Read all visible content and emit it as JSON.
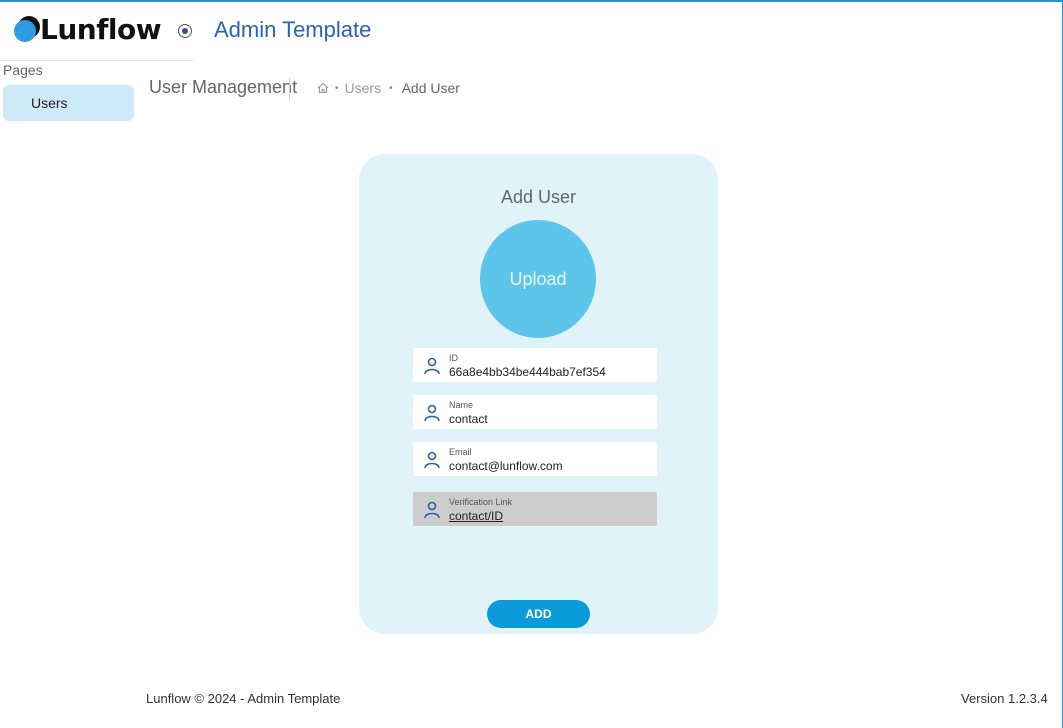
{
  "header": {
    "logo_text": "Lunflow",
    "app_title": "Admin Template",
    "accent_color": "#2e62ad"
  },
  "sidebar": {
    "section_label": "Pages",
    "items": [
      {
        "label": "Users",
        "active": true
      }
    ]
  },
  "breadcrumb": {
    "page_heading": "User Management",
    "home_icon": "home-icon",
    "items": [
      "Users",
      "Add User"
    ]
  },
  "form": {
    "title": "Add User",
    "upload_label": "Upload",
    "fields": [
      {
        "label": "ID",
        "value": "66a8e4bb34be444bab7ef354",
        "icon": "user-icon"
      },
      {
        "label": "Name",
        "value": "contact",
        "icon": "user-icon"
      },
      {
        "label": "Email",
        "value": "contact@lunflow.com",
        "icon": "user-icon"
      },
      {
        "label": "Verification Link",
        "value": "contact/ID",
        "icon": "user-icon",
        "disabled": true
      }
    ],
    "submit_label": "ADD"
  },
  "footer": {
    "copyright": "Lunflow © 2024 - Admin Template",
    "version": "Version 1.2.3.4"
  }
}
